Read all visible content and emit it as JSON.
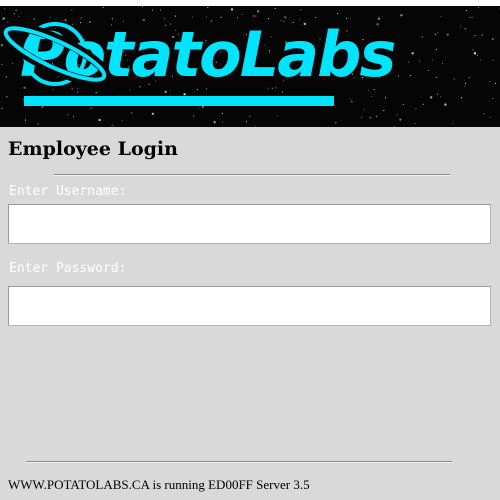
{
  "header": {
    "logo_text": "PotatoLabs",
    "accent_color": "#00e5ff",
    "planet_icon": "ringed-planet-icon"
  },
  "login": {
    "title": "Employee Login",
    "username_label": "Enter Username:",
    "username_value": "",
    "password_label": "Enter Password:",
    "password_value": ""
  },
  "footer": {
    "text": "WWW.POTATOLABS.CA is running ED00FF Server 3.5"
  }
}
